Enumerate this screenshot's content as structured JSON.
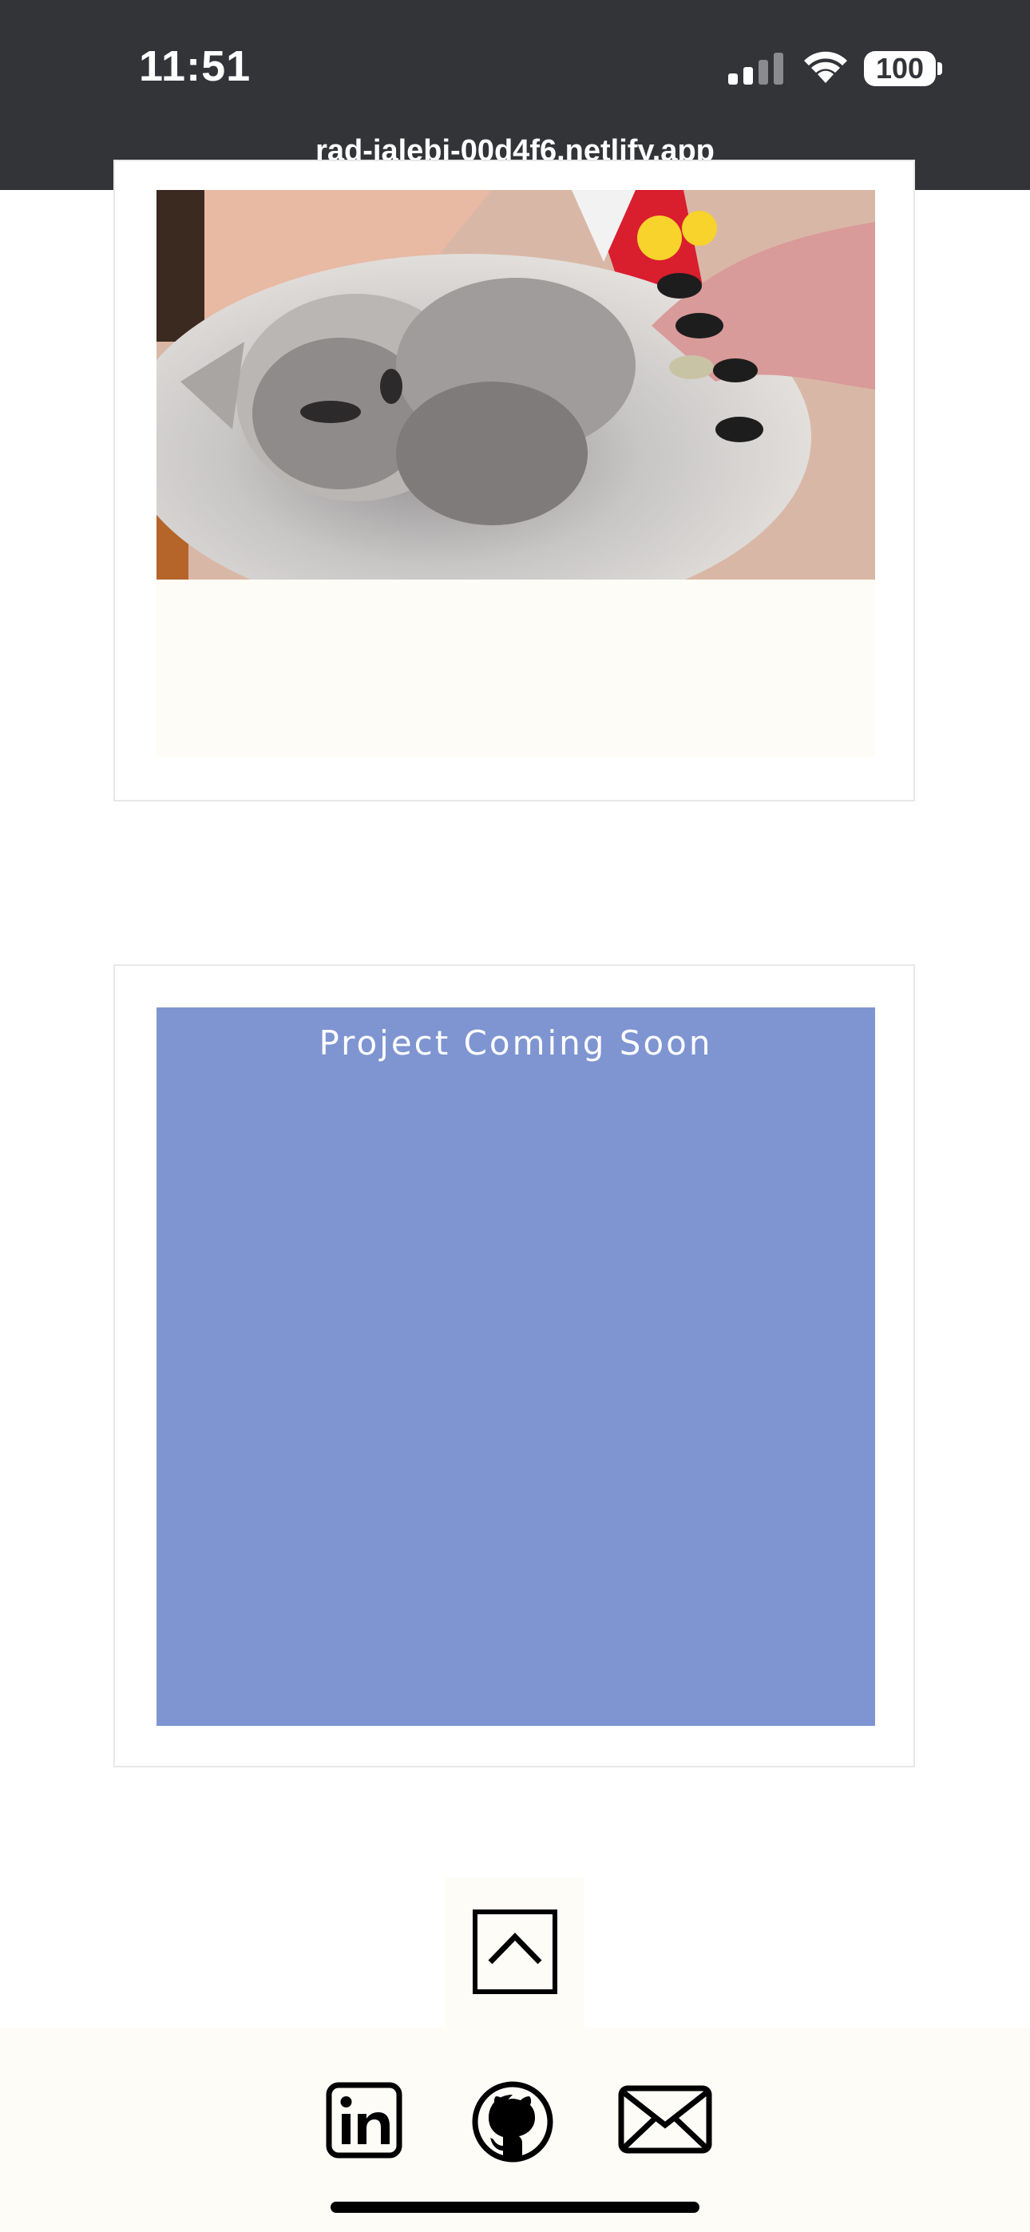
{
  "status_bar": {
    "time": "11:51",
    "battery": "100",
    "url": "rad-jalebi-00d4f6.netlify.app"
  },
  "projects": [
    {
      "image_icon": "cat-photo",
      "caption": ""
    },
    {
      "title": "Project Coming Soon",
      "color": "#7f95d1"
    }
  ],
  "back_to_top": {
    "icon": "chevron-up-icon"
  },
  "footer": {
    "links": [
      {
        "icon": "linkedin-icon"
      },
      {
        "icon": "github-icon"
      },
      {
        "icon": "mail-icon"
      }
    ]
  },
  "colors": {
    "status_bar_bg": "#323438",
    "card_placeholder": "#7f95d1",
    "footer_bg": "#fdfcf6"
  }
}
